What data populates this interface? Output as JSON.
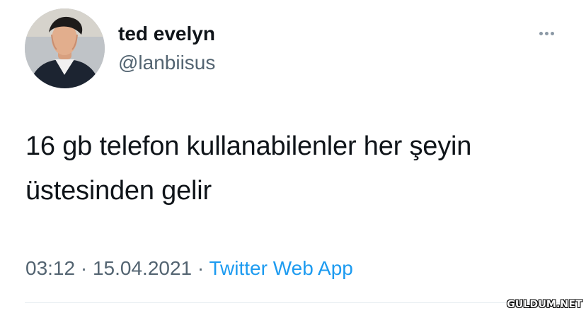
{
  "tweet": {
    "author": {
      "display_name": "ted evelyn",
      "handle": "@lanbiisus",
      "avatar_icon": "avatar-photo-icon"
    },
    "more_icon": "more-options-icon",
    "text_lines": [
      "16 gb telefon kullanabilenler her şeyin",
      "üstesinden gelir"
    ],
    "meta": {
      "time": "03:12",
      "separator": " · ",
      "date": "15.04.2021",
      "source": "Twitter Web App"
    }
  },
  "watermark": "GULDUM.NET",
  "colors": {
    "text_primary": "#0f1419",
    "text_secondary": "#536471",
    "accent": "#1d9bf0",
    "divider": "#e6ecf0"
  }
}
